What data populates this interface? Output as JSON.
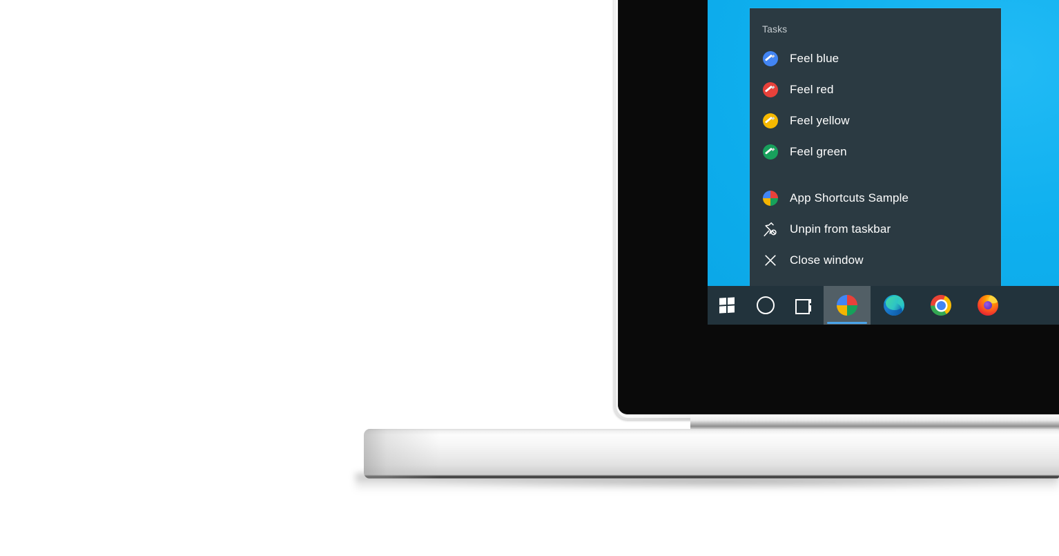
{
  "device": {
    "type": "laptop",
    "bezel_color": "#0a0a0a",
    "body_color": "#f2f2f2"
  },
  "desktop": {
    "wallpaper_color": "#11b2f0"
  },
  "jump_list": {
    "background_color": "#2b3a42",
    "title": "Tasks",
    "tasks": [
      {
        "label": "Feel blue",
        "icon": "brush-blue-icon",
        "color": "#4285f4"
      },
      {
        "label": "Feel red",
        "icon": "brush-red-icon",
        "color": "#e8413a"
      },
      {
        "label": "Feel yellow",
        "icon": "brush-yellow-icon",
        "color": "#f6b900"
      },
      {
        "label": "Feel green",
        "icon": "brush-green-icon",
        "color": "#18a05c"
      }
    ],
    "actions": [
      {
        "label": "App Shortcuts Sample",
        "icon": "pie-app-icon"
      },
      {
        "label": "Unpin from taskbar",
        "icon": "unpin-icon"
      },
      {
        "label": "Close window",
        "icon": "close-icon"
      }
    ]
  },
  "taskbar": {
    "background_color": "#22333c",
    "active_underline_color": "#4aa3e8",
    "buttons": [
      {
        "name": "start-button",
        "icon": "windows-logo-icon",
        "label": "Start",
        "active": false
      },
      {
        "name": "cortana-button",
        "icon": "cortana-circle-icon",
        "label": "Cortana",
        "active": false
      },
      {
        "name": "task-view-button",
        "icon": "task-view-icon",
        "label": "Task View",
        "active": false
      },
      {
        "name": "app-shortcuts-sample-button",
        "icon": "pie-app-icon",
        "label": "App Shortcuts Sample",
        "active": true
      },
      {
        "name": "edge-button",
        "icon": "edge-icon",
        "label": "Microsoft Edge",
        "active": false
      },
      {
        "name": "chrome-button",
        "icon": "chrome-icon",
        "label": "Google Chrome",
        "active": false
      },
      {
        "name": "firefox-button",
        "icon": "firefox-icon",
        "label": "Mozilla Firefox",
        "active": false
      }
    ]
  }
}
